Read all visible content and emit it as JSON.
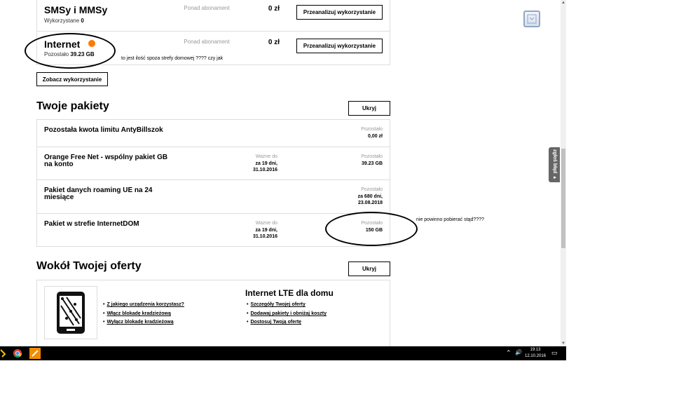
{
  "services": [
    {
      "name": "SMSy i MMSy",
      "sub_label": "Wykorzystane",
      "sub_value": "0",
      "over_label": "Ponad abonament",
      "price": "0 zł",
      "button": "Przeanalizuj wykorzystanie"
    },
    {
      "name": "Internet",
      "sub_label": "Pozostało",
      "sub_value": "39.23 GB",
      "over_label": "Ponad abonament",
      "price": "0 zł",
      "button": "Przeanalizuj wykorzystanie"
    }
  ],
  "annotations": {
    "internet_note": "to jest ilość spoza strefy domowej ???? czy jak",
    "package_note": "nie powinno pobierać stąd????"
  },
  "see_usage_button": "Zobacz wykorzystanie",
  "packages_section": {
    "title": "Twoje pakiety",
    "hide_button": "Ukryj",
    "items": [
      {
        "name": "Pozostała kwota limitu AntyBillszok",
        "valid_label": "",
        "valid_value": "",
        "remain_label": "Pozostało",
        "remain_value": "0,00 zł"
      },
      {
        "name": "Orange Free Net - wspólny pakiet GB na konto",
        "valid_label": "Ważne do",
        "valid_value": "za 19 dni, 31.10.2016",
        "remain_label": "Pozostało",
        "remain_value": "39.23 GB"
      },
      {
        "name": "Pakiet danych roaming UE na 24 miesiące",
        "valid_label": "",
        "valid_value": "",
        "remain_label": "Pozostało",
        "remain_value": "za 680 dni, 23.08.2018"
      },
      {
        "name": "Pakiet w strefie InternetDOM",
        "valid_label": "Ważne do",
        "valid_value": "za 19 dni, 31.10.2016",
        "remain_label": "Pozostało",
        "remain_value": "150 GB"
      }
    ]
  },
  "offer_section": {
    "title": "Wokół Twojej oferty",
    "hide_button": "Ukryj",
    "device_links": [
      "Z jakiego urządzenia korzystasz?",
      "Włącz blokadę kradzieżową",
      "Wyłącz blokadę kradzieżową"
    ],
    "lte_title": "Internet LTE dla domu",
    "lte_links": [
      "Szczegóły Twojej oferty",
      "Dodawaj pakiety i obniżaj koszty",
      "Dostosuj Twoją ofertę"
    ]
  },
  "feedback_tab": "zgłoś błąd ▸",
  "taskbar": {
    "time": "19:13",
    "date": "12.10.2016"
  },
  "colors": {
    "accent": "#ff7900",
    "border": "#dddddd",
    "muted": "#999999"
  },
  "icons": [
    "info-badge-icon",
    "phone-icon",
    "chrome-icon",
    "orange-app-icon",
    "speaker-icon",
    "notification-icon",
    "chevron-up-icon"
  ]
}
